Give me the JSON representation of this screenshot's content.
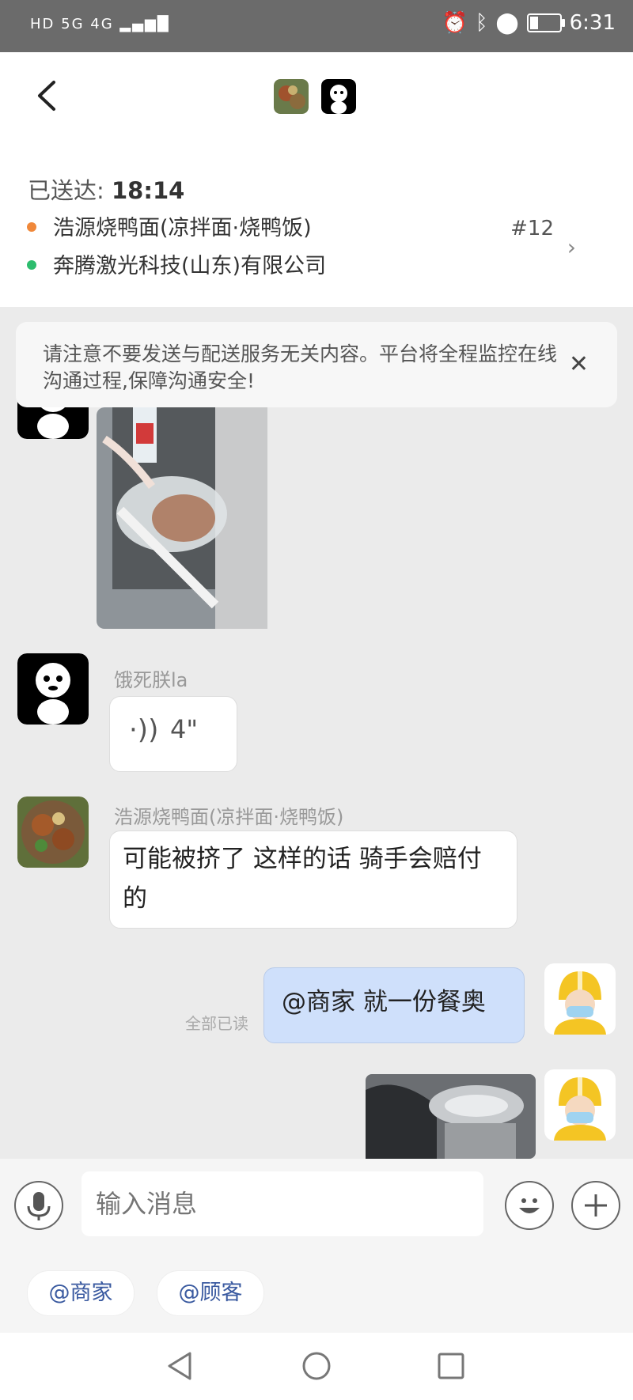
{
  "status_bar": {
    "left_icons": "HD 5G 4G",
    "time": "6:31"
  },
  "order": {
    "delivered_label": "已送达:",
    "delivered_time": "18:14",
    "merchant": "浩源烧鸭面(凉拌面·烧鸭饭)",
    "destination": "奔腾激光科技(山东)有限公司",
    "order_number": "#12",
    "merchant_dot_color": "#f0883a",
    "destination_dot_color": "#2dbd6e"
  },
  "notice": {
    "text": "请注意不要发送与配送服务无关内容。平台将全程监控在线沟通过程,保障沟通安全!"
  },
  "messages": {
    "voice_sender": "饿死朕la",
    "voice_duration": "4\"",
    "merchant_sender": "浩源烧鸭面(凉拌面·烧鸭饭)",
    "merchant_text": "可能被挤了 这样的话 骑手会赔付的",
    "my_text": "@商家 就一份餐奥",
    "read_status": "全部已读"
  },
  "input": {
    "placeholder": "输入消息"
  },
  "quick_mentions": [
    "@商家",
    "@顾客"
  ],
  "colors": {
    "my_bubble": "#cfe0fb",
    "accent_link": "#3a5aa0"
  }
}
